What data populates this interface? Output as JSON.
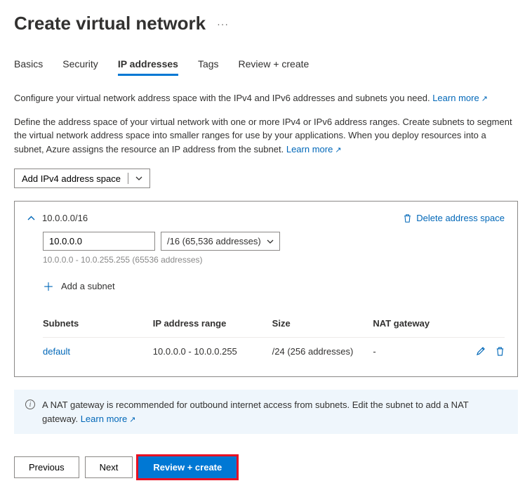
{
  "title": "Create virtual network",
  "tabs": [
    "Basics",
    "Security",
    "IP addresses",
    "Tags",
    "Review + create"
  ],
  "activeTabIndex": 2,
  "intro": "Configure your virtual network address space with the IPv4 and IPv6 addresses and subnets you need.",
  "introLink": "Learn more",
  "desc": "Define the address space of your virtual network with one or more IPv4 or IPv6 address ranges. Create subnets to segment the virtual network address space into smaller ranges for use by your applications. When you deploy resources into a subnet, Azure assigns the resource an IP address from the subnet.",
  "descLink": "Learn more",
  "addSpaceLabel": "Add IPv4 address space",
  "addressSpace": {
    "cidr": "10.0.0.0/16",
    "ip": "10.0.0.0",
    "mask": "/16 (65,536 addresses)",
    "rangeHint": "10.0.0.0 - 10.0.255.255 (65536 addresses)",
    "deleteLabel": "Delete address space"
  },
  "addSubnetLabel": "Add a subnet",
  "subnetHeaders": {
    "name": "Subnets",
    "range": "IP address range",
    "size": "Size",
    "nat": "NAT gateway"
  },
  "subnets": [
    {
      "name": "default",
      "range": "10.0.0.0 - 10.0.0.255",
      "size": "/24 (256 addresses)",
      "nat": "-"
    }
  ],
  "infoText": "A NAT gateway is recommended for outbound internet access from subnets. Edit the subnet to add a NAT gateway.",
  "infoLink": "Learn more",
  "footer": {
    "previous": "Previous",
    "next": "Next",
    "review": "Review + create"
  }
}
